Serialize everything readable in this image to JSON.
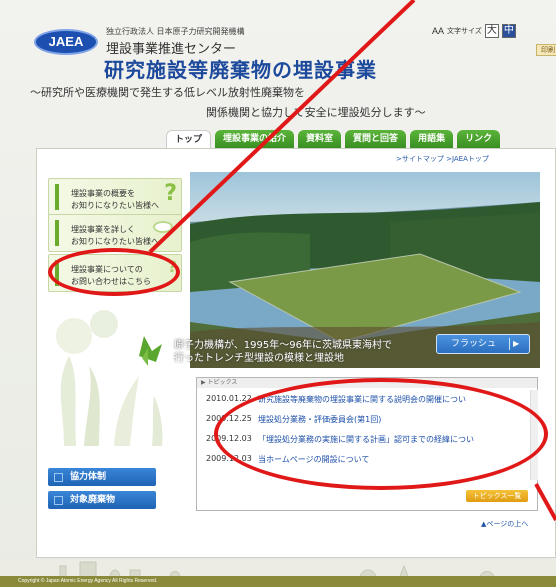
{
  "header": {
    "logo_text": "JAEA",
    "org_line1": "独立行政法人 日本原子力研究開発機構",
    "org_line2": "埋設事業推進センター",
    "fontsize_prefix": "AA",
    "fontsize_label": "文字サイズ",
    "fontsize_large": "大",
    "fontsize_medium": "中",
    "print_label": "印刷"
  },
  "main": {
    "title": "研究施設等廃棄物の埋設事業",
    "subtitle_line1": "〜研究所や医療機関で発生する低レベル放射性廃棄物を",
    "subtitle_line2": "関係機関と協力して安全に埋設処分します〜"
  },
  "tabs": [
    "トップ",
    "埋設事業の紹介",
    "資料室",
    "質問と回答",
    "用語集",
    "リンク"
  ],
  "top_links": ">サイトマップ  >JAEAトップ",
  "sidebar": {
    "items": [
      {
        "line1": "埋設事業の概要を",
        "line2": "お知りになりたい皆様へ"
      },
      {
        "line1": "埋設事業を詳しく",
        "line2": "お知りになりたい皆様へ"
      },
      {
        "line1": "埋設事業についての",
        "line2": "お問い合わせはこちら"
      }
    ],
    "buttons": [
      "協力体制",
      "対象廃棄物"
    ]
  },
  "photo": {
    "caption_line1": "原子力機構が、1995年〜96年に茨城県東海村で",
    "caption_line2": "行ったトレンチ型埋設の模様と埋設地",
    "flash_label": "フラッシュ",
    "play_symbol": "▶"
  },
  "topics": {
    "header": "▶ トピックス",
    "items": [
      {
        "date": "2010.01.22",
        "title": "研究施設等廃棄物の埋設事業に関する説明会の開催につい"
      },
      {
        "date": "2009.12.25",
        "title": "埋設処分業務・評価委員会(第1回)"
      },
      {
        "date": "2009.12.03",
        "title": "「埋設処分業務の実施に関する計画」認可までの経緯につい"
      },
      {
        "date": "2009.12.03",
        "title": "当ホームページの開設について"
      }
    ],
    "more_label": "トピックス一覧",
    "page_top": "▲ページの上へ"
  },
  "footer": {
    "copyright": "Copyright © Japan Atomic Energy Agency All Rights Reserved."
  },
  "annotation_color": "#e01818"
}
